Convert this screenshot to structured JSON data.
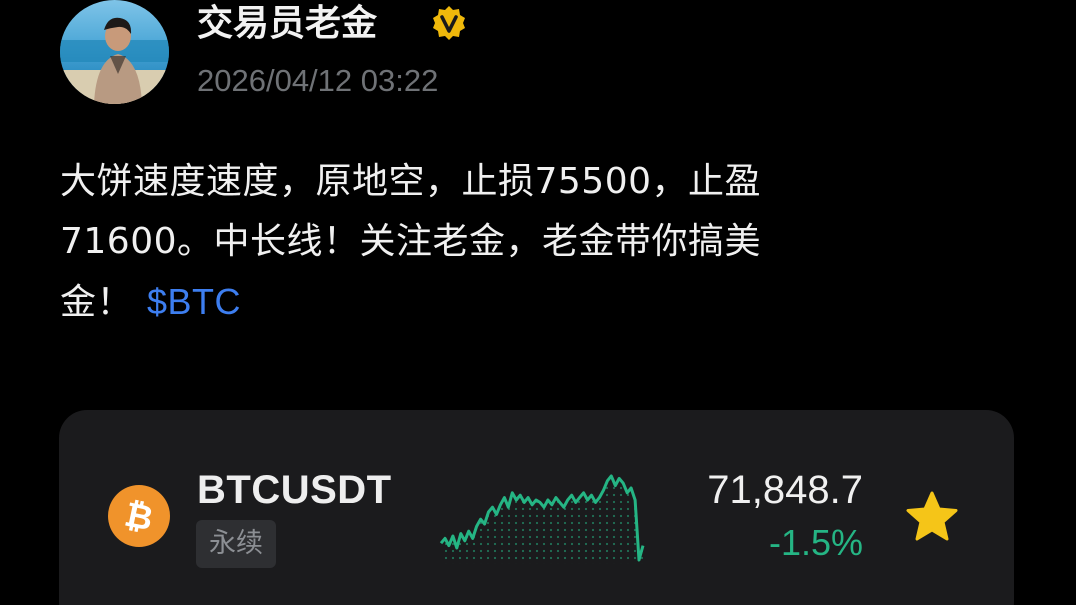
{
  "author": {
    "name": "交易员老金",
    "verified_icon": "verified-badge-icon",
    "timestamp": "2026/04/12 03:22"
  },
  "post": {
    "lines": [
      "大饼速度速度，原地空，止损75500，止盈",
      "71600。中长线！关注老金，老金带你搞美",
      "金！"
    ],
    "ticker_tag": "$BTC"
  },
  "market_card": {
    "coin_icon": "bitcoin-icon",
    "symbol": "BTCUSDT",
    "contract_type": "永续",
    "price": "71,848.7",
    "change": "-1.5%",
    "favorite_icon": "star-icon",
    "colors": {
      "change": "#25b584",
      "sparkline": "#25b584",
      "star": "#f5c518",
      "coin": "#f0932b"
    },
    "sparkline_values": [
      45,
      47,
      44,
      48,
      43,
      49,
      46,
      50,
      47,
      52,
      55,
      53,
      58,
      60,
      57,
      61,
      64,
      60,
      66,
      63,
      65,
      62,
      64,
      61,
      63,
      62,
      60,
      63,
      61,
      64,
      62,
      60,
      63,
      65,
      62,
      64,
      66,
      63,
      65,
      62,
      64,
      67,
      71,
      73,
      69,
      72,
      70,
      66,
      68,
      63,
      38,
      44
    ]
  }
}
